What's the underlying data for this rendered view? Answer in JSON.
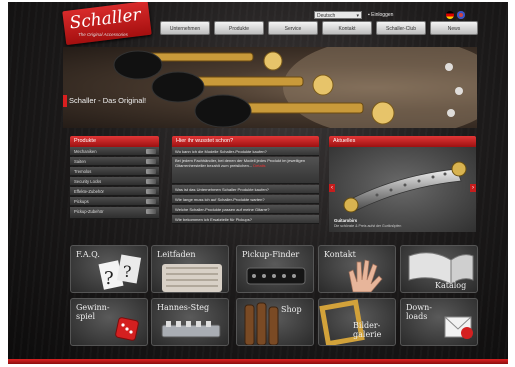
{
  "brand": {
    "logo_text": "Schaller",
    "tagline": "The Original Accessories"
  },
  "utility": {
    "language": "Deutsch",
    "login": "Einloggen"
  },
  "nav": [
    "Unternehmen",
    "Produkte",
    "Service",
    "Kontakt",
    "Schaller-Club",
    "News"
  ],
  "hero": {
    "caption": "Schaller - Das Original!"
  },
  "produkte": {
    "title": "Produkte",
    "items": [
      "Mechaniken",
      "Saiten",
      "Tremolos",
      "Security Locks",
      "Effekte-Zubehör",
      "Pickups",
      "Pickup-Zubehör"
    ]
  },
  "faq": {
    "title": "Hier ihr wusstet schon?",
    "items": [
      "Wo kann ich die Modelle Schaller-Produkte kaufen?",
      "Bei jedem Fachhändler, bei denen der Modell jedes Produkt im jeweiligen Gitarrenhersteller bezahlt zum preislichen...",
      "Was ist das Unternehmen Schaller Produkte kaufen?",
      "Wie lange muss ich auf Schaller-Produkte warten?",
      "Welche Schaller-Produkte passen auf meine Gitarre?",
      "Wie bekommen ich Ersatzteile für Pickups?"
    ],
    "more_label": "Details"
  },
  "news": {
    "title": "Aktuelles",
    "item_title": "Guitarobirs",
    "item_sub": "Die schönste & Preis aufst der Gurtknöpfen"
  },
  "tiles": [
    "F.A.Q.",
    "Leitfaden",
    "Pickup-Finder",
    "Kontakt",
    "Katalog",
    "Gewinn-spiel",
    "Hannes-Steg",
    "Shop",
    "Bilder-galerie",
    "Down-loads"
  ]
}
